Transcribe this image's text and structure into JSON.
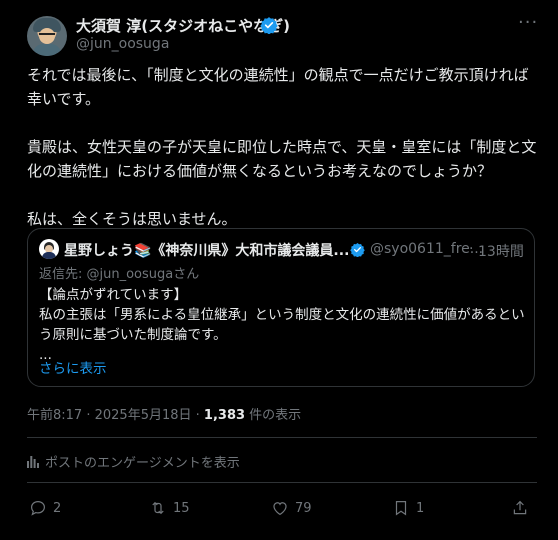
{
  "author": {
    "name": "大須賀 淳(スタジオねこやなぎ)",
    "handle": "@jun_oosuga"
  },
  "more_icon": "more-dots-icon",
  "tweet": {
    "paragraphs": [
      "それでは最後に、「制度と文化の連続性」の観点で一点だけご教示頂ければ幸いです。",
      "貴殿は、女性天皇の子が天皇に即位した時点で、天皇・皇室には「制度と文化の連続性」における価値が無くなるというお考えなのでしょうか？",
      "私は、全くそうは思いません。"
    ]
  },
  "quote": {
    "name": "星野しょう📚《神奈川県》大和市議会議員...",
    "handle": "@syo0611_fre...",
    "separator": "·",
    "time": "13時間",
    "reply_to": "返信先: @jun_oosugaさん",
    "lines": [
      "【論点がずれています】",
      "私の主張は「男系による皇位継承」という制度と文化の連続性に価値があるとい",
      "う原則に基づいた制度論です。",
      "..."
    ],
    "show_more": "さらに表示"
  },
  "meta": {
    "time": "午前8:17",
    "sep": " · ",
    "date": "2025年5月18日",
    "sep2": " · ",
    "views": "1,383",
    "views_label": " 件の表示"
  },
  "engagement_link": "ポストのエンゲージメントを表示",
  "actions": {
    "replies": "2",
    "reposts": "15",
    "likes": "79",
    "bookmarks": "1"
  },
  "colors": {
    "background": "#000000",
    "text": "#e7e9ea",
    "secondary": "#71767b",
    "accent": "#1d9bf0",
    "border": "#2f3336"
  }
}
